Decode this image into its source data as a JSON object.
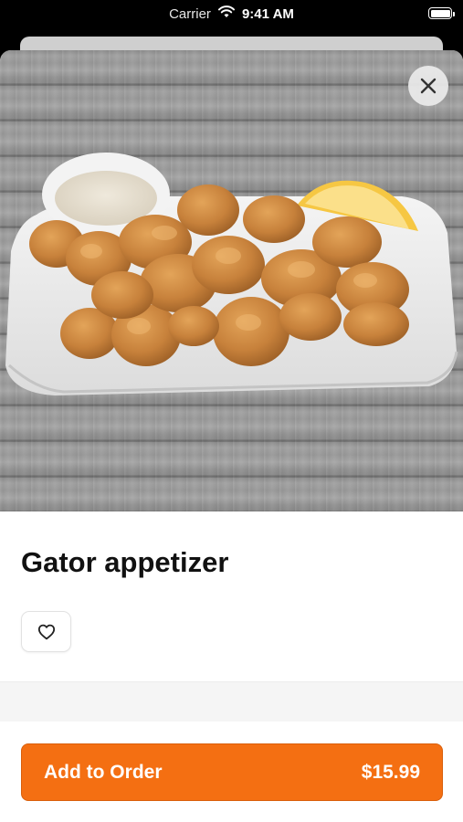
{
  "status_bar": {
    "carrier": "Carrier",
    "time": "9:41 AM",
    "icons": [
      "wifi-icon",
      "battery-icon"
    ]
  },
  "item": {
    "name": "Gator appetizer",
    "image_description_icon": "food-photo"
  },
  "actions": {
    "favorite_icon": "heart-outline-icon",
    "close_icon": "close-icon"
  },
  "order_button": {
    "label": "Add to Order",
    "price": "$15.99"
  },
  "colors": {
    "accent": "#f46f12",
    "text": "#111111",
    "band": "#f5f5f5"
  }
}
